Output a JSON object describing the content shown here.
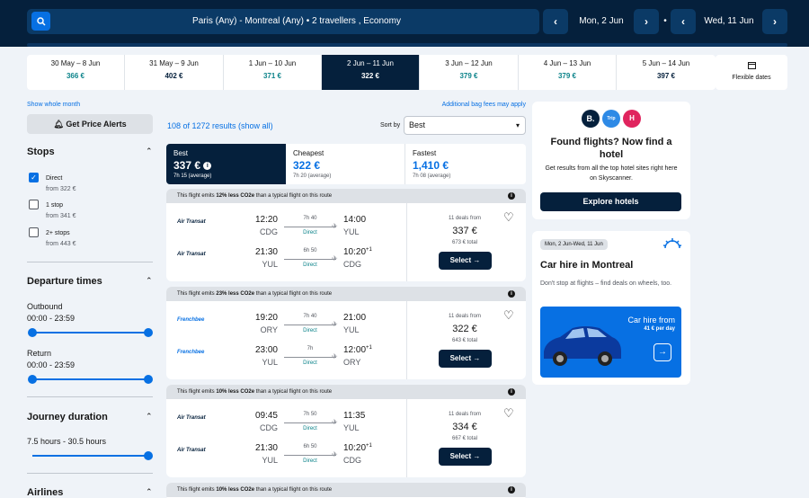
{
  "header": {
    "search_summary": "Paris (Any) - Montreal (Any)  •  2 travellers , Economy",
    "depart_date": "Mon, 2 Jun",
    "return_date": "Wed, 11 Jun",
    "separator": "•"
  },
  "date_tabs": [
    {
      "range": "30 May – 8 Jun",
      "price": "366 €"
    },
    {
      "range": "31 May – 9 Jun",
      "price": "402 €"
    },
    {
      "range": "1 Jun – 10 Jun",
      "price": "371 €"
    },
    {
      "range": "2 Jun – 11 Jun",
      "price": "322 €"
    },
    {
      "range": "3 Jun – 12 Jun",
      "price": "379 €"
    },
    {
      "range": "4 Jun – 13 Jun",
      "price": "379 €"
    },
    {
      "range": "5 Jun – 14 Jun",
      "price": "397 €"
    }
  ],
  "flexible_dates": "Flexible dates",
  "show_whole_month": "Show whole month",
  "bag_fees": "Additional bag fees may apply",
  "price_alerts": "Get Price Alerts",
  "results_count": "108 of 1272 results (show all)",
  "sort": {
    "label": "Sort by",
    "value": "Best"
  },
  "filters": {
    "stops_title": "Stops",
    "stops": [
      {
        "label": "Direct",
        "sub": "from 322 €",
        "checked": true
      },
      {
        "label": "1 stop",
        "sub": "from 341 €",
        "checked": false
      },
      {
        "label": "2+ stops",
        "sub": "from 443 €",
        "checked": false
      }
    ],
    "departure_title": "Departure times",
    "outbound_label": "Outbound",
    "outbound_range": "00:00 - 23:59",
    "return_label": "Return",
    "return_range": "00:00 - 23:59",
    "duration_title": "Journey duration",
    "duration_range": "7.5 hours - 30.5 hours",
    "airlines_title": "Airlines"
  },
  "sort_tabs": [
    {
      "label": "Best",
      "price": "337 €",
      "sub": "7h 15 (average)"
    },
    {
      "label": "Cheapest",
      "price": "322 €",
      "sub": "7h 20 (average)"
    },
    {
      "label": "Fastest",
      "price": "1,410 €",
      "sub": "7h 08 (average)"
    }
  ],
  "results": [
    {
      "eco_pre": "This flight emits ",
      "eco_bold": "12% less CO2e",
      "eco_post": " than a typical flight on this route",
      "legs": [
        {
          "airline": "Air Transat",
          "dep_time": "12:20",
          "dep_code": "CDG",
          "duration": "7h 40",
          "stops": "Direct",
          "arr_time": "14:00",
          "arr_code": "YUL",
          "plus": ""
        },
        {
          "airline": "Air Transat",
          "dep_time": "21:30",
          "dep_code": "YUL",
          "duration": "6h 50",
          "stops": "Direct",
          "arr_time": "10:20",
          "arr_code": "CDG",
          "plus": "+1"
        }
      ],
      "deals": "11 deals from",
      "price": "337 €",
      "total": "673 € total",
      "select": "Select →"
    },
    {
      "eco_pre": "This flight emits ",
      "eco_bold": "23% less CO2e",
      "eco_post": " than a typical flight on this route",
      "legs": [
        {
          "airline": "Frenchbee",
          "dep_time": "19:20",
          "dep_code": "ORY",
          "duration": "7h 40",
          "stops": "Direct",
          "arr_time": "21:00",
          "arr_code": "YUL",
          "plus": ""
        },
        {
          "airline": "Frenchbee",
          "dep_time": "23:00",
          "dep_code": "YUL",
          "duration": "7h",
          "stops": "Direct",
          "arr_time": "12:00",
          "arr_code": "ORY",
          "plus": "+1"
        }
      ],
      "deals": "11 deals from",
      "price": "322 €",
      "total": "643 € total",
      "select": "Select →"
    },
    {
      "eco_pre": "This flight emits ",
      "eco_bold": "10% less CO2e",
      "eco_post": " than a typical flight on this route",
      "legs": [
        {
          "airline": "Air Transat",
          "dep_time": "09:45",
          "dep_code": "CDG",
          "duration": "7h 50",
          "stops": "Direct",
          "arr_time": "11:35",
          "arr_code": "YUL",
          "plus": ""
        },
        {
          "airline": "Air Transat",
          "dep_time": "21:30",
          "dep_code": "YUL",
          "duration": "6h 50",
          "stops": "Direct",
          "arr_time": "10:20",
          "arr_code": "CDG",
          "plus": "+1"
        }
      ],
      "deals": "11 deals from",
      "price": "334 €",
      "total": "667 € total",
      "select": "Select →"
    }
  ],
  "partial_eco": {
    "eco_pre": "This flight emits ",
    "eco_bold": "10% less CO2e",
    "eco_post": " than a typical flight on this route"
  },
  "hotel_card": {
    "title": "Found flights? Now find a hotel",
    "body": "Get results from all the top hotel sites right here on Skyscanner.",
    "button": "Explore hotels",
    "logos": [
      "B.",
      "Trip",
      "H"
    ]
  },
  "car_card": {
    "dates": "Mon, 2 Jun-Wed, 11 Jun",
    "title": "Car hire in Montreal",
    "body": "Don't stop at flights – find deals on wheels, too.",
    "promo_title": "Car hire from",
    "promo_price": "41 € per day",
    "promo_arrow": "→"
  },
  "colors": {
    "navy": "#05203c",
    "blue": "#0770e3",
    "teal": "#0c838a"
  },
  "icons": {
    "search": "search-icon",
    "calendar": "calendar-icon",
    "bell": "bell-icon",
    "heart": "heart-icon",
    "plane": "plane-icon",
    "sun": "sun-logo-icon"
  }
}
